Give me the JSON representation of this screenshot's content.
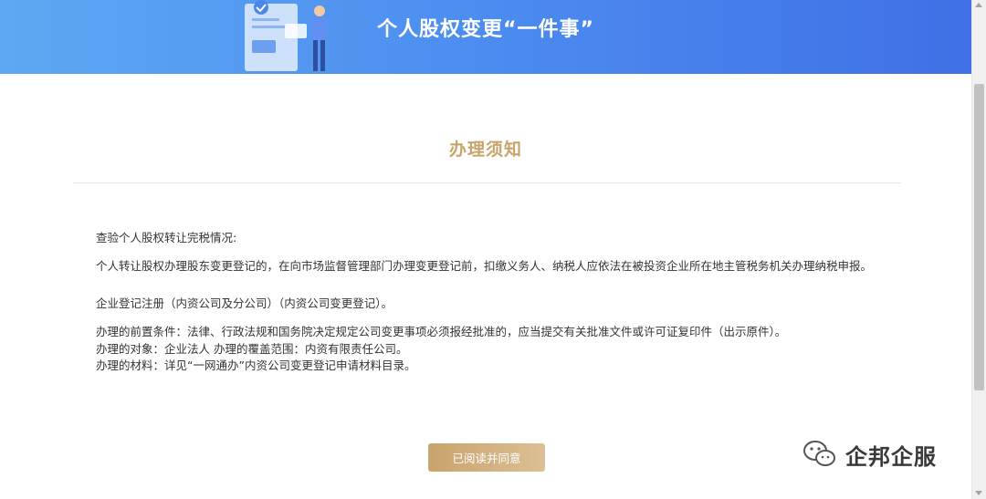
{
  "banner": {
    "title": "个人股权变更“一件事”"
  },
  "section": {
    "heading": "办理须知"
  },
  "notice": {
    "lines": [
      "查验个人股权转让完税情况:",
      "个人转让股权办理股东变更登记的，在向市场监督管理部门办理变更登记前，扣缴义务人、纳税人应依法在被投资企业所在地主管税务机关办理纳税申报。",
      "企业登记注册（内资公司及分公司）（内资公司变更登记）。",
      "办理的前置条件：法律、行政法规和国务院决定规定公司变更事项必须报经批准的，应当提交有关批准文件或许可证复印件（出示原件）。",
      "办理的对象：企业法人 办理的覆盖范围：内资有限责任公司。",
      "办理的材料：详见“一网通办”内资公司变更登记申请材料目录。"
    ]
  },
  "actions": {
    "agree_label": "已阅读并同意"
  },
  "watermark": {
    "text": "企邦企服",
    "icon": "wechat-icon"
  },
  "colors": {
    "banner_start": "#5ea8f2",
    "banner_end": "#3f70e6",
    "accent_gold": "#c8a46b"
  }
}
